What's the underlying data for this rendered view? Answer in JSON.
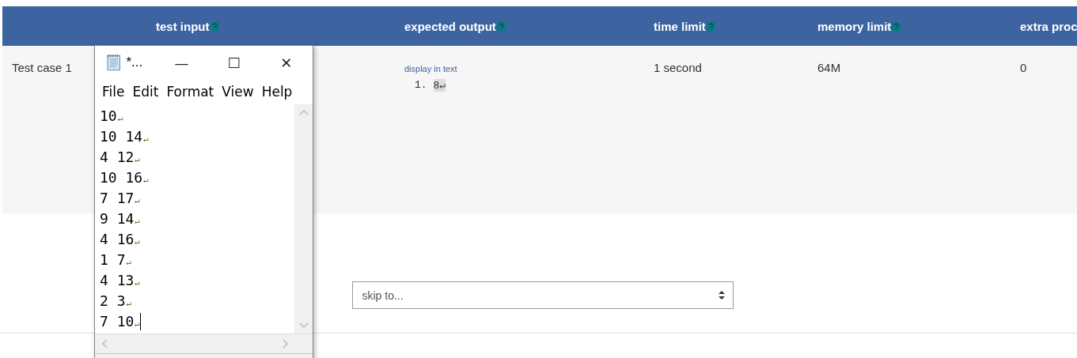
{
  "table": {
    "columns": [
      {
        "label": "test input",
        "help": true
      },
      {
        "label": "expected output",
        "help": true
      },
      {
        "label": "time limit",
        "help": true
      },
      {
        "label": "memory limit",
        "help": true
      },
      {
        "label": "extra proc"
      }
    ],
    "rows": [
      {
        "name": "Test case 1",
        "expected": {
          "link": "display in text",
          "lines": [
            {
              "number": "1.",
              "text": "8↵"
            }
          ]
        },
        "time_limit": "1 second",
        "memory_limit": "64M",
        "extra": "0"
      }
    ]
  },
  "skip": {
    "placeholder": "skip to..."
  },
  "notepad": {
    "title": "*...",
    "buttons": [
      "—",
      "☐",
      "✕"
    ],
    "menu": [
      "File",
      "Edit",
      "Format",
      "View",
      "Help"
    ],
    "lines": [
      {
        "text": "10",
        "mark": "↵",
        "caret": false
      },
      {
        "text": "10 14",
        "mark": "↵",
        "caret": false
      },
      {
        "text": "4 12",
        "mark": "↵",
        "caret": false
      },
      {
        "text": "10 16",
        "mark": "↵",
        "caret": false
      },
      {
        "text": "7 17",
        "mark": "↵",
        "caret": false
      },
      {
        "text": "9 14",
        "mark": "↵",
        "caret": false
      },
      {
        "text": "4 16",
        "mark": "↵",
        "caret": false
      },
      {
        "text": "1 7",
        "mark": "↵",
        "caret": false
      },
      {
        "text": "4 13",
        "mark": "↵",
        "caret": false
      },
      {
        "text": "2 3",
        "mark": "↵",
        "caret": false
      },
      {
        "text": "7 10",
        "mark": "↵",
        "caret": true
      }
    ]
  }
}
